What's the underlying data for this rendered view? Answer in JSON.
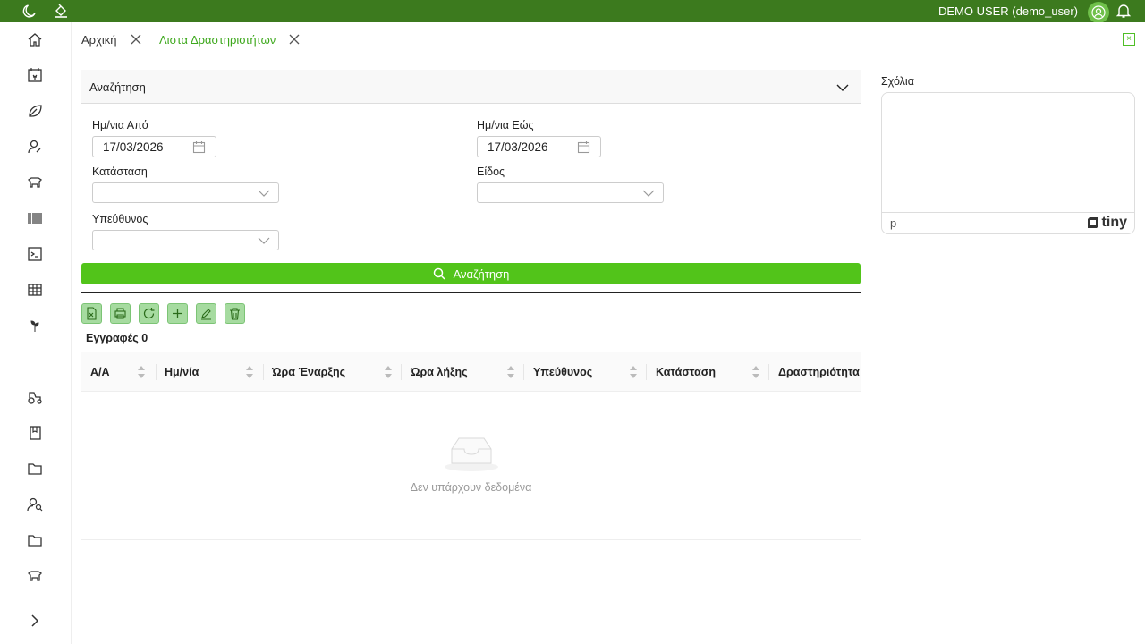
{
  "header": {
    "user_label": "DEMO USER (demo_user)"
  },
  "tabs": [
    {
      "label": "Αρχική"
    },
    {
      "label": "Λιστα Δραστηριοτήτων"
    }
  ],
  "search": {
    "panel_title": "Αναζήτηση",
    "date_from_label": "Ημ/νια Από",
    "date_from_value": "17/03/2026",
    "date_to_label": "Ημ/νια Εώς",
    "date_to_value": "17/03/2026",
    "status_label": "Κατάσταση",
    "type_label": "Είδος",
    "responsible_label": "Υπεύθυνος",
    "button_label": "Αναζήτηση"
  },
  "records_label": "Εγγραφές 0",
  "table": {
    "columns": [
      "Α/Α",
      "Ημ/νία",
      "Ώρα Έναρξης",
      "Ώρα λήξης",
      "Υπεύθυνος",
      "Κατάσταση",
      "Δραστηριότητα"
    ],
    "empty_text": "Δεν υπάρχουν δεδομένα"
  },
  "comments": {
    "label": "Σχόλια",
    "status_path": "p",
    "brand": "tiny"
  },
  "colors": {
    "topbar": "#3c7a1e",
    "accent": "#52c41a",
    "toolbar_button": "#a6dba0"
  }
}
